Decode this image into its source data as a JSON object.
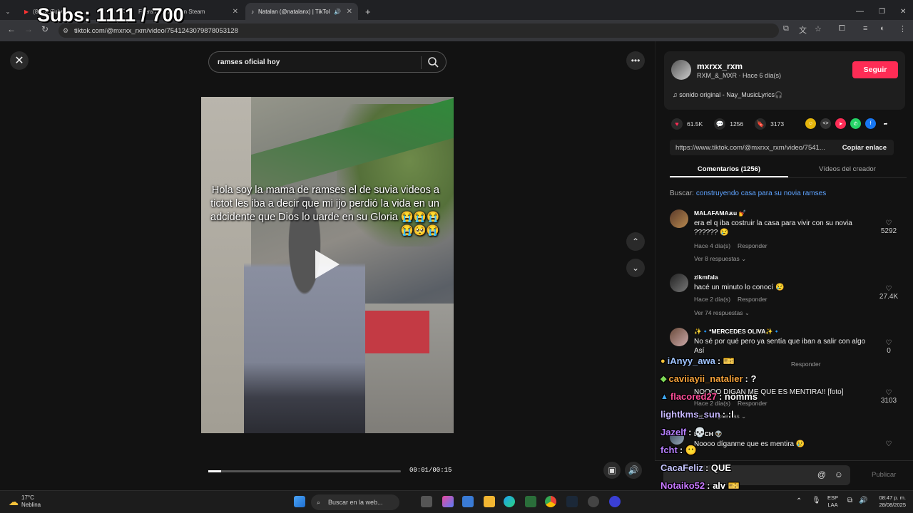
{
  "browser": {
    "tabs": [
      {
        "label": "(8) YouTube"
      },
      {
        "label": "Fuera del rather en Steam"
      },
      {
        "label": "Natalan (@natalanx) | TikTok"
      }
    ],
    "url": "tiktok.com/@mxrxx_rxm/video/7541243079878053128"
  },
  "overlay": {
    "subs_text": "Subs: 1111 / 700"
  },
  "player": {
    "search_placeholder": "ramses oficial hoy",
    "caption": "Hola soy la mama de ramses el de suvia videos a tictot les iba a decir que mi ijo perdió la vida en un adcidente que Dios lo uarde en su Gloria 😭😭😭😭🥺😭",
    "time": "00:01/00:15",
    "progress": 0.0667
  },
  "author": {
    "username": "mxrxx_rxm",
    "subtitle": "RXM_&_MXR · Hace 6 día(s)",
    "follow_label": "Seguir",
    "sound": "♫  sonido original - Nay_MusicLyrics🎧"
  },
  "stats": {
    "likes": "61.5K",
    "comments": "1256",
    "saves": "3173"
  },
  "share": {
    "link": "https://www.tiktok.com/@mxrxx_rxm/video/7541...",
    "copy_label": "Copiar enlace"
  },
  "panel_tabs": {
    "comments": "Comentarios (1256)",
    "videos": "Vídeos del creador"
  },
  "search_hint": {
    "label": "Buscar:",
    "query": "construyendo casa para su novia ramses"
  },
  "comments": [
    {
      "user": "MALAFAMAѫu 💅",
      "text": "era el q iba costruir la casa para vivir con su novia ?????? 😢",
      "time": "Hace 4 día(s)",
      "reply": "Responder",
      "more": "Ver 8 respuestas ⌄",
      "likes": "5292"
    },
    {
      "user": "zlkmfala",
      "text": "hacé un minuto lo conocí 😢",
      "time": "Hace 2 día(s)",
      "reply": "Responder",
      "more": "Ver 74 respuestas ⌄",
      "likes": "27.4K"
    },
    {
      "user": "✨🔹*MERCEDES OLIVA✨🔹",
      "text": "No sé por qué pero ya sentía que iban a salir con algo Así",
      "time": "",
      "reply": "Responder",
      "more": "",
      "likes": "0"
    },
    {
      "user": "",
      "text": "NOOOO DIGAN ME QUE ES MENTIRA!! [foto]",
      "time": "Hace 2 día(s)",
      "reply": "Responder",
      "more": "Ver 5 respuestas ⌄",
      "likes": "3103"
    },
    {
      "user": "Lia CH 👽",
      "text": "Noooo díganme que es mentira 😢",
      "time": "",
      "reply": "",
      "more": "",
      "likes": ""
    }
  ],
  "comment_input": {
    "publish": "Publicar"
  },
  "chat": [
    {
      "name": "iAnyy_awa",
      "msg": ": 🎫",
      "color": "#9fc3ff"
    },
    {
      "name": "caviiayii_natalier",
      "msg": ": ?",
      "color": "#f6a23a"
    },
    {
      "name": "flacored27",
      "msg": ": nomms",
      "color": "#ff4f9a"
    },
    {
      "name": "lightkms_sun",
      "msg": ": :l",
      "color": "#c7b8ff"
    },
    {
      "name": "Jazelf",
      "msg": ": 💀",
      "color": "#b780ff"
    },
    {
      "name": "fcht",
      "msg": ": 😶",
      "color": "#b780ff"
    },
    {
      "name": "CacaFeliz",
      "msg": ": QUE",
      "color": "#c6c6ff"
    },
    {
      "name": "Notaiko52",
      "msg": ": alv 🎫",
      "color": "#c878ff"
    }
  ],
  "taskbar": {
    "temp": "17°C",
    "weather": "Neblina",
    "search": "Buscar en la web...",
    "lang1": "ESP",
    "lang2": "LAA",
    "time": "08:47 p. m.",
    "date": "28/08/2025"
  }
}
